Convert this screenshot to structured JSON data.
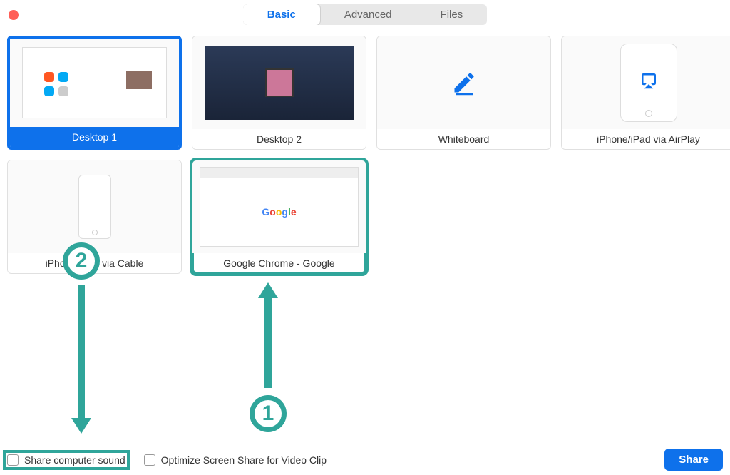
{
  "tabs": {
    "basic": "Basic",
    "advanced": "Advanced",
    "files": "Files",
    "active": "basic"
  },
  "tiles": {
    "desktop1": "Desktop 1",
    "desktop2": "Desktop 2",
    "whiteboard": "Whiteboard",
    "airplay": "iPhone/iPad via AirPlay",
    "cable": "iPhone/iPad via Cable",
    "chrome": "Google Chrome - Google"
  },
  "footer": {
    "share_sound": "Share computer sound",
    "optimize": "Optimize Screen Share for Video Clip",
    "share_btn": "Share"
  },
  "annotations": {
    "one": "1",
    "two": "2"
  },
  "colors": {
    "accent_blue": "#0e71eb",
    "annotation_teal": "#2fa59a"
  }
}
